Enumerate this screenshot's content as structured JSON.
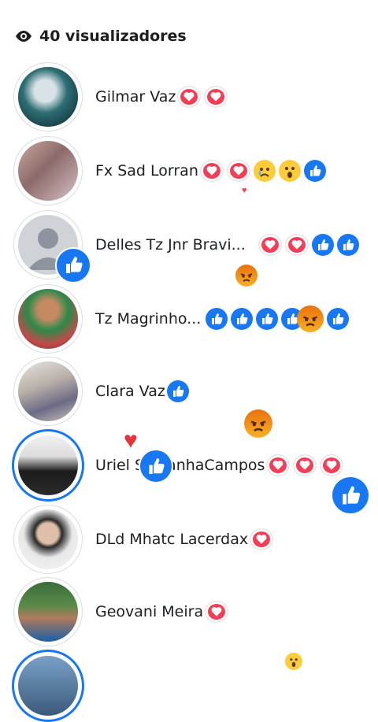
{
  "header": {
    "viewers_label": "40 visualizadores",
    "icon": "eye-icon"
  },
  "viewers": [
    {
      "name": "Gilmar Vaz",
      "reactions": [
        "love",
        "love"
      ]
    },
    {
      "name": "Fx Sad Lorran",
      "reactions": [
        "love",
        "love",
        "sad",
        "wow",
        "like"
      ]
    },
    {
      "name": "Delles Tz Jnr Bravi...",
      "reactions": [
        "love",
        "love",
        "like",
        "like"
      ]
    },
    {
      "name": "Tz Magrinho...",
      "reactions": [
        "like",
        "like",
        "like",
        "like",
        "angry",
        "like"
      ]
    },
    {
      "name": "Clara Vaz",
      "reactions": [
        "like"
      ]
    },
    {
      "name": "Uriel SaldanhaCampos",
      "reactions": [
        "love",
        "love",
        "love"
      ]
    },
    {
      "name": "DLd Mhatc Lacerdax",
      "reactions": [
        "love"
      ]
    },
    {
      "name": "Geovani Meira",
      "reactions": [
        "love"
      ]
    }
  ],
  "colors": {
    "like": "#1877f2",
    "love": "#f33e58",
    "text": "#1c1e21",
    "ring": "#1877f2"
  }
}
